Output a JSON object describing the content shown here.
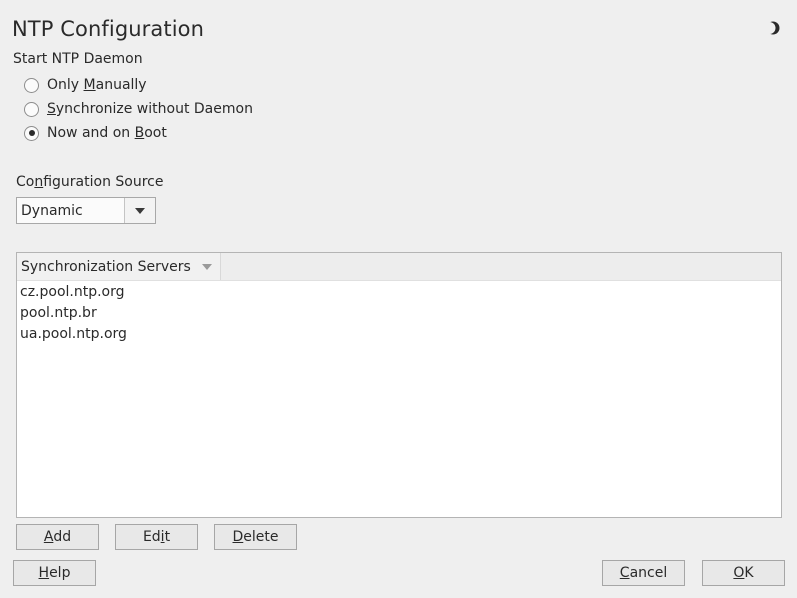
{
  "window": {
    "title": "NTP Configuration",
    "theme_icon": "moon-icon"
  },
  "daemon": {
    "label": "Start NTP Daemon",
    "options": [
      {
        "pre": "Only ",
        "mn": "M",
        "post": "anually",
        "checked": false
      },
      {
        "pre": "",
        "mn": "S",
        "post": "ynchronize without Daemon",
        "checked": false
      },
      {
        "pre": "Now and on ",
        "mn": "B",
        "post": "oot",
        "checked": true
      }
    ]
  },
  "config_source": {
    "label_pre": "Co",
    "label_mn": "n",
    "label_post": "figuration Source",
    "selected": "Dynamic"
  },
  "servers": {
    "column_header": "Synchronization Servers",
    "rows": [
      "cz.pool.ntp.org",
      "pool.ntp.br",
      "ua.pool.ntp.org"
    ]
  },
  "actions": {
    "add": {
      "pre": "",
      "mn": "A",
      "post": "dd"
    },
    "edit": {
      "pre": "Ed",
      "mn": "i",
      "post": "t"
    },
    "delete": {
      "pre": "",
      "mn": "D",
      "post": "elete"
    }
  },
  "footer": {
    "help": {
      "pre": "",
      "mn": "H",
      "post": "elp"
    },
    "cancel": {
      "pre": "",
      "mn": "C",
      "post": "ancel"
    },
    "ok": {
      "pre": "",
      "mn": "O",
      "post": "K"
    }
  }
}
